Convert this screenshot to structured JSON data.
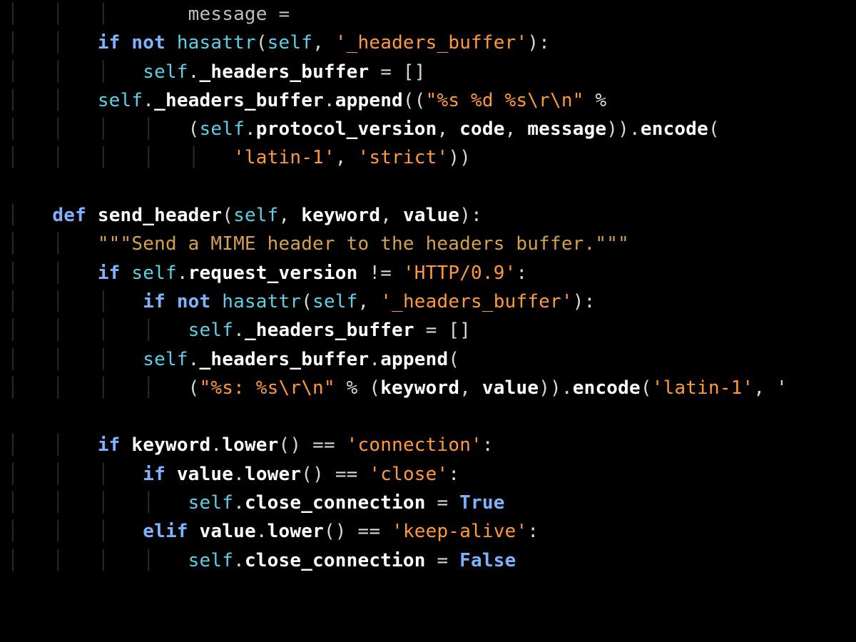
{
  "code": {
    "partial_top": "message =",
    "l1": {
      "kw_if": "if",
      "kw_not": "not",
      "fn_hasattr": "hasattr",
      "self": "self",
      "str_hb": "'_headers_buffer'"
    },
    "l2": {
      "self": "self",
      "attr": "_headers_buffer",
      "eq": "=",
      "empty": "[]"
    },
    "l3": {
      "self": "self",
      "attr": "_headers_buffer",
      "method": "append",
      "open": "((",
      "str_fmt": "\"%s %d %s\\r\\n\"",
      "pct": "%"
    },
    "l4": {
      "self": "self",
      "pv": "protocol_version",
      "code": "code",
      "msg": "message",
      "enc": "encode",
      "close": "))."
    },
    "l5": {
      "s1": "'latin-1'",
      "s2": "'strict'",
      "close": "))"
    },
    "l7": {
      "def": "def",
      "name": "send_header",
      "self": "self",
      "p1": "keyword",
      "p2": "value"
    },
    "l8": {
      "doc": "\"\"\"Send a MIME header to the headers buffer.\"\"\""
    },
    "l9": {
      "if": "if",
      "self": "self",
      "rv": "request_version",
      "ne": "!=",
      "http": "'HTTP/0.9'"
    },
    "l10": {
      "if": "if",
      "not": "not",
      "hasattr": "hasattr",
      "self": "self",
      "hb": "'_headers_buffer'"
    },
    "l11": {
      "self": "self",
      "attr": "_headers_buffer",
      "eq": "=",
      "empty": "[]"
    },
    "l12": {
      "self": "self",
      "attr": "_headers_buffer",
      "method": "append",
      "open": "("
    },
    "l13": {
      "open": "(",
      "fmt": "\"%s: %s\\r\\n\"",
      "pct": "%",
      "kw": "keyword",
      "val": "value",
      "enc": "encode",
      "s1": "'latin-1'",
      "trail": ", '"
    },
    "l15": {
      "if": "if",
      "kw": "keyword",
      "lower": "lower",
      "eq": "==",
      "conn": "'connection'"
    },
    "l16": {
      "if": "if",
      "val": "value",
      "lower": "lower",
      "eq": "==",
      "close": "'close'"
    },
    "l17": {
      "self": "self",
      "attr": "close_connection",
      "eq": "=",
      "true": "True"
    },
    "l18": {
      "elif": "elif",
      "val": "value",
      "lower": "lower",
      "eq": "==",
      "ka": "'keep-alive'"
    },
    "l19": {
      "self": "self",
      "attr": "close_connection",
      "eq": "=",
      "false": "False"
    }
  }
}
